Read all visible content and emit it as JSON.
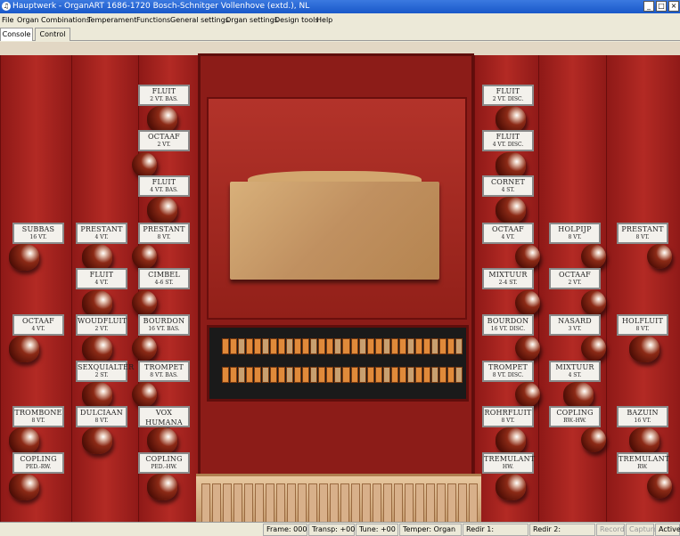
{
  "title_bar": {
    "icon": "organ-icon",
    "title": "Hauptwerk - OrganART 1686-1720  Bosch-Schnitger Vollenhove (extd.), NL"
  },
  "window_buttons": {
    "minimize": "_",
    "maximize": "□",
    "close": "×"
  },
  "menu": [
    "File",
    "Organ",
    "Combinations",
    "Temperament",
    "Functions",
    "General settings",
    "Organ settings",
    "Design tools",
    "Help"
  ],
  "tabs": [
    {
      "label": "Console",
      "active": true
    },
    {
      "label": "Control",
      "active": false
    }
  ],
  "stops": [
    {
      "name": "FLUIT",
      "sub": "2 VT. BAS."
    },
    {
      "name": "OCTAAF",
      "sub": "2 VT."
    },
    {
      "name": "FLUIT",
      "sub": "4 VT. BAS."
    },
    {
      "name": "PRESTANT",
      "sub": "8 VT."
    },
    {
      "name": "CIMBEL",
      "sub": "4-6 ST."
    },
    {
      "name": "BOURDON",
      "sub": "16 VT. BAS."
    },
    {
      "name": "TROMPET",
      "sub": "8 VT. BAS."
    },
    {
      "name": "VOX HUMANA",
      "sub": "8 VT."
    },
    {
      "name": "COPLING",
      "sub": "PED.-HW."
    },
    {
      "name": "SUBBAS",
      "sub": "16 VT."
    },
    {
      "name": "OCTAAF",
      "sub": "4 VT."
    },
    {
      "name": "TROMBONE",
      "sub": "8 VT."
    },
    {
      "name": "COPLING",
      "sub": "PED.-RW."
    },
    {
      "name": "PRESTANT",
      "sub": "4 VT."
    },
    {
      "name": "FLUIT",
      "sub": "4 VT."
    },
    {
      "name": "WOUDFLUIT",
      "sub": "2 VT."
    },
    {
      "name": "SEXQUIALTER",
      "sub": "2 ST."
    },
    {
      "name": "DULCIAAN",
      "sub": "8 VT."
    },
    {
      "name": "FLUIT",
      "sub": "2 VT. DISC."
    },
    {
      "name": "FLUIT",
      "sub": "4 VT. DISC."
    },
    {
      "name": "CORNET",
      "sub": "4 ST."
    },
    {
      "name": "OCTAAF",
      "sub": "4 VT."
    },
    {
      "name": "MIXTUUR",
      "sub": "2-4 ST."
    },
    {
      "name": "BOURDON",
      "sub": "16 VT. DISC."
    },
    {
      "name": "TROMPET",
      "sub": "8 VT. DISC."
    },
    {
      "name": "ROHRFLUIT",
      "sub": "8 VT."
    },
    {
      "name": "TREMULANT",
      "sub": "HW."
    },
    {
      "name": "HOLPIJP",
      "sub": "8 VT."
    },
    {
      "name": "OCTAAF",
      "sub": "2 VT."
    },
    {
      "name": "NASARD",
      "sub": "3 VT."
    },
    {
      "name": "MIXTUUR",
      "sub": "4 ST."
    },
    {
      "name": "COPLING",
      "sub": "RW.-HW."
    },
    {
      "name": "PRESTANT",
      "sub": "8 VT."
    },
    {
      "name": "HOLFLUIT",
      "sub": "8 VT."
    },
    {
      "name": "BAZUIN",
      "sub": "16 VT."
    },
    {
      "name": "TREMULANT",
      "sub": "RW."
    }
  ],
  "status": {
    "frame": "Frame: 000",
    "transp": "Transp: +00",
    "tune": "Tune: +00",
    "temper": "Temper: Organ",
    "redir1": "Redir 1:",
    "redir2": "Redir 2:",
    "record": "Record",
    "capture": "Capture",
    "active": "Active"
  },
  "colors": {
    "case": "#8c1c18",
    "plank": "#b32a24",
    "label_bg": "#f3f1ec",
    "titlebar": "#1958c9",
    "manual_keys": "#e08a3a"
  }
}
